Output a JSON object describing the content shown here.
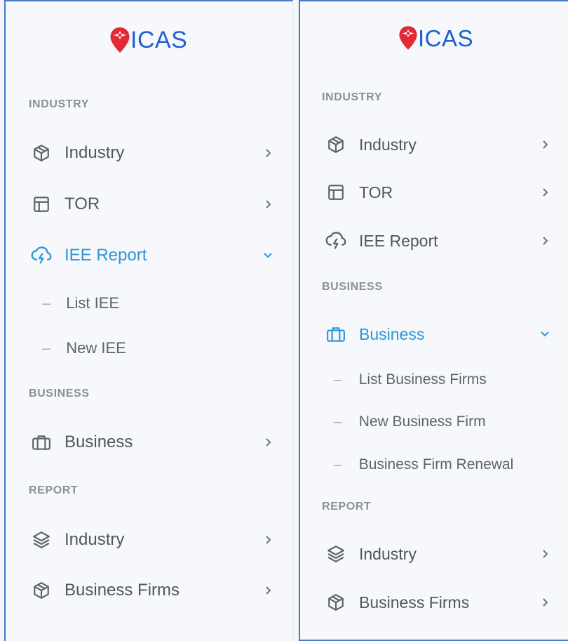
{
  "colors": {
    "brand": "#1f5fcf",
    "logo_marker": "#e12b34",
    "active": "#2f96d8",
    "text": "#4e5661",
    "section": "#8a9099",
    "panel_border": "#4a78c8"
  },
  "left": {
    "logo": "ICAS",
    "sections": {
      "industry": "INDUSTRY",
      "business": "BUSINESS",
      "report": "REPORT"
    },
    "items": {
      "industry": {
        "label": "Industry",
        "icon": "box-icon"
      },
      "tor": {
        "label": "TOR",
        "icon": "layout-icon"
      },
      "iee_report": {
        "label": "IEE Report",
        "icon": "cloud-lightning-icon",
        "expanded": true
      },
      "business": {
        "label": "Business",
        "icon": "briefcase-icon"
      },
      "report_industry": {
        "label": "Industry",
        "icon": "layers-icon"
      },
      "report_business_firms": {
        "label": "Business Firms",
        "icon": "box-icon"
      }
    },
    "subitems": {
      "list_iee": "List IEE",
      "new_iee": "New IEE"
    }
  },
  "right": {
    "logo": "ICAS",
    "sections": {
      "industry": "INDUSTRY",
      "business": "BUSINESS",
      "report": "REPORT"
    },
    "items": {
      "industry": {
        "label": "Industry",
        "icon": "box-icon"
      },
      "tor": {
        "label": "TOR",
        "icon": "layout-icon"
      },
      "iee_report": {
        "label": "IEE Report",
        "icon": "cloud-lightning-icon"
      },
      "business": {
        "label": "Business",
        "icon": "briefcase-icon",
        "expanded": true
      },
      "report_industry": {
        "label": "Industry",
        "icon": "layers-icon"
      },
      "report_business_firms": {
        "label": "Business Firms",
        "icon": "box-icon"
      }
    },
    "subitems": {
      "list_business_firms": "List Business Firms",
      "new_business_firm": "New Business Firm",
      "business_firm_renewal": "Business Firm Renewal"
    }
  }
}
